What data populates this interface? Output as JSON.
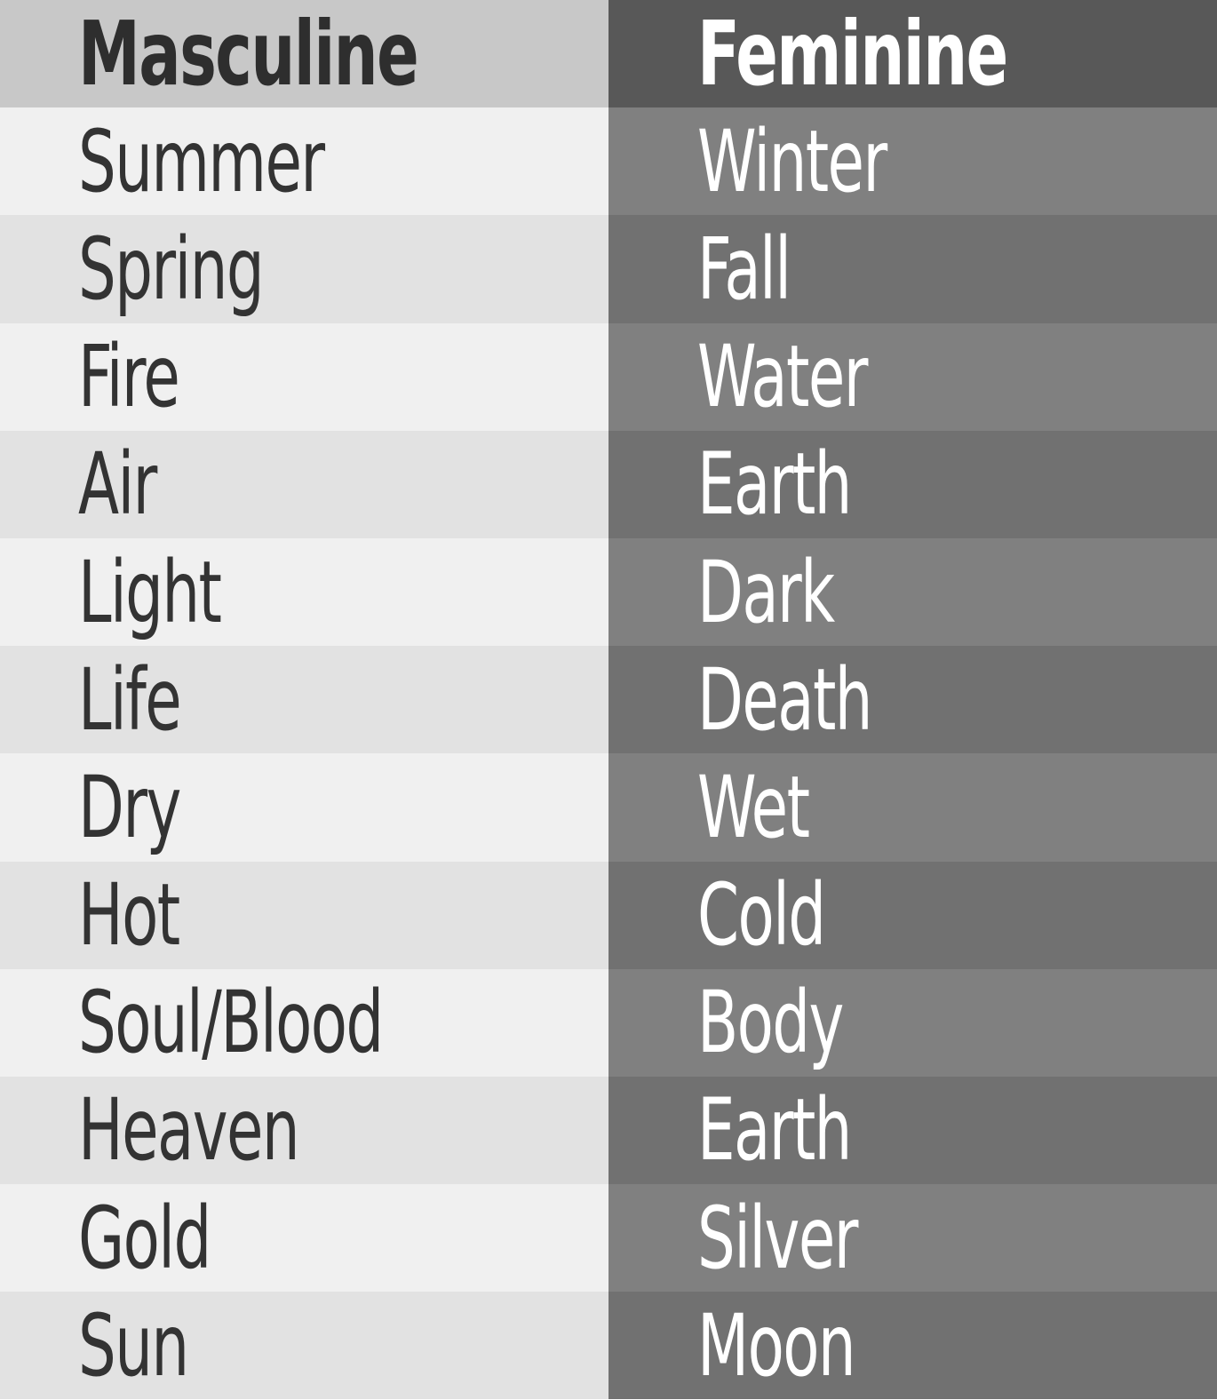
{
  "headers": {
    "masculine": "Masculine",
    "feminine": "Feminine"
  },
  "rows": [
    {
      "masculine": "Summer",
      "feminine": "Winter"
    },
    {
      "masculine": "Spring",
      "feminine": "Fall"
    },
    {
      "masculine": "Fire",
      "feminine": "Water"
    },
    {
      "masculine": "Air",
      "feminine": "Earth"
    },
    {
      "masculine": "Light",
      "feminine": "Dark"
    },
    {
      "masculine": "Life",
      "feminine": "Death"
    },
    {
      "masculine": "Dry",
      "feminine": "Wet"
    },
    {
      "masculine": "Hot",
      "feminine": "Cold"
    },
    {
      "masculine": "Soul/Blood",
      "feminine": "Body"
    },
    {
      "masculine": "Heaven",
      "feminine": "Earth"
    },
    {
      "masculine": "Gold",
      "feminine": "Silver"
    },
    {
      "masculine": "Sun",
      "feminine": "Moon"
    }
  ],
  "colors": {
    "header_masculine_bg": "#c8c8c8",
    "header_feminine_bg": "#585858",
    "masculine_light": "#f0f0f0",
    "masculine_dark": "#e2e2e2",
    "feminine_light": "#808080",
    "feminine_dark": "#717171",
    "masculine_text": "#333333",
    "feminine_text": "#ffffff"
  }
}
